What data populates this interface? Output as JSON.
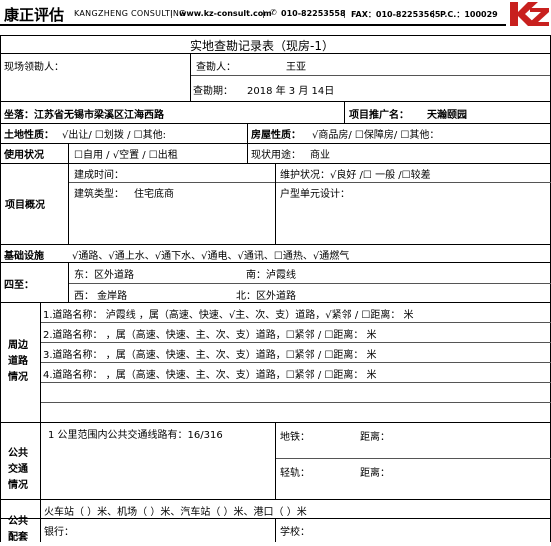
{
  "header": {
    "company": "康正评估",
    "brand": "KANGZHENG CONSULTING",
    "web": "www.kz-consult.com",
    "phone": "010-82253558",
    "fax": "FAX：010-82253565",
    "postcode": "P.C.：100029",
    "accent_color": "#c8201e"
  },
  "form": {
    "title": "实地查勘记录表（现房-1）",
    "r1": {
      "lead": "现场领勘人：",
      "surveyor": "查勘人：",
      "surveyor_name": "王亚"
    },
    "r2": {
      "date_label": "查勘期：",
      "date_value": "2018 年 3 月 14日"
    },
    "r3": {
      "loc_label": "坐落：江苏省无锡市梁溪区江海西路",
      "proj_label": "项目推广名：",
      "proj_value": "天瀚颐园"
    },
    "r4": {
      "land_label": "土地性质：",
      "land_value": "√出让/ ☐划拨 / ☐其他:",
      "house_label": "房屋性质：",
      "house_value": "√商品房/ ☐保障房/ ☐其他："
    },
    "r5": {
      "use_label": "使用状况",
      "use_value": "☐自用 / √空置 / ☐出租",
      "cur_label": "现状用途：",
      "cur_value": "商业"
    },
    "overview": {
      "label": "项目概况",
      "built_time": "建成时间：",
      "maint": "维护状况：√良好 /☐ 一般 /☐较差",
      "type_label": "建筑类型：",
      "type_value": "住宅底商",
      "unit_design": "户型单元设计："
    },
    "infra": {
      "label": "基础设施",
      "value": "√通路、√通上水、√通下水、√通电、√通讯、☐通热、√通燃气"
    },
    "boundary": {
      "label": "四至：",
      "east": "东：区外道路",
      "south": "南：泸霞线",
      "west": "西：  金岸路",
      "north": "北：区外道路"
    },
    "roads": {
      "label": [
        "周边",
        "道路",
        "情况"
      ],
      "items": [
        "1.道路名称：  泸霞线    ，属（高速、快速、√主、次、支）道路，√紧邻 / ☐距离：   米",
        "2.道路名称：       ，属（高速、快速、主、次、支）道路，☐紧邻 / ☐距离：  米",
        "3.道路名称：       ，属（高速、快速、主、次、支）道路，☐紧邻 / ☐距离：  米",
        "4.道路名称：       ，属（高速、快速、主、次、支）道路，☐紧邻 / ☐距离：  米"
      ]
    },
    "transport": {
      "label": [
        "公共",
        "交通",
        "情况"
      ],
      "bus": "1 公里范围内公共交通线路有：16/316",
      "metro": "地铁：",
      "metro_dist": "距离：",
      "light_rail": "轻轨：",
      "light_rail_dist": "距离：",
      "hubs": "火车站（  ）米、机场（  ）米、汽车站（  ）米、港口（  ）米"
    },
    "facilities": {
      "label": [
        "公共",
        "配套"
      ],
      "bank": "银行：",
      "school": "学校："
    }
  }
}
